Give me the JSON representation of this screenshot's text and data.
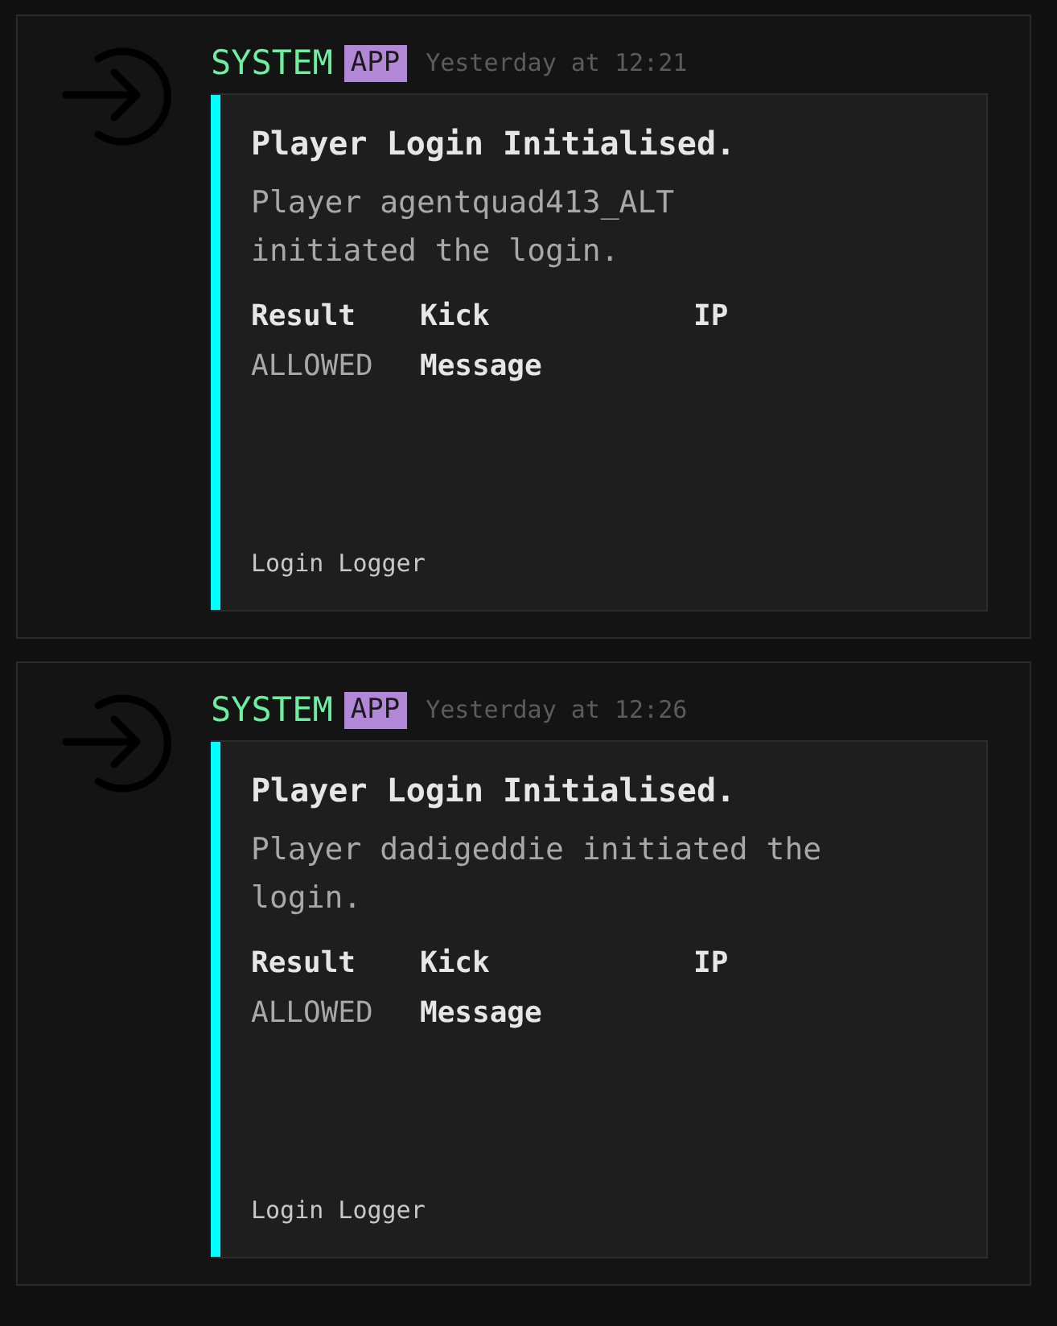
{
  "messages": [
    {
      "author": "SYSTEM",
      "badge": "APP",
      "time": "Yesterday at 12:21",
      "embed": {
        "title": "Player Login Initialised.",
        "description": "Player agentquad413_ALT initiated the login.",
        "fields": [
          {
            "name": "Result",
            "value": "ALLOWED"
          },
          {
            "name": "Kick Message"
          },
          {
            "name": "IP"
          }
        ],
        "footer": "Login Logger"
      }
    },
    {
      "author": "SYSTEM",
      "badge": "APP",
      "time": "Yesterday at 12:26",
      "embed": {
        "title": "Player Login Initialised.",
        "description": "Player dadigeddie initiated the login.",
        "fields": [
          {
            "name": "Result",
            "value": "ALLOWED"
          },
          {
            "name": "Kick Message"
          },
          {
            "name": "IP"
          }
        ],
        "footer": "Login Logger"
      }
    }
  ]
}
